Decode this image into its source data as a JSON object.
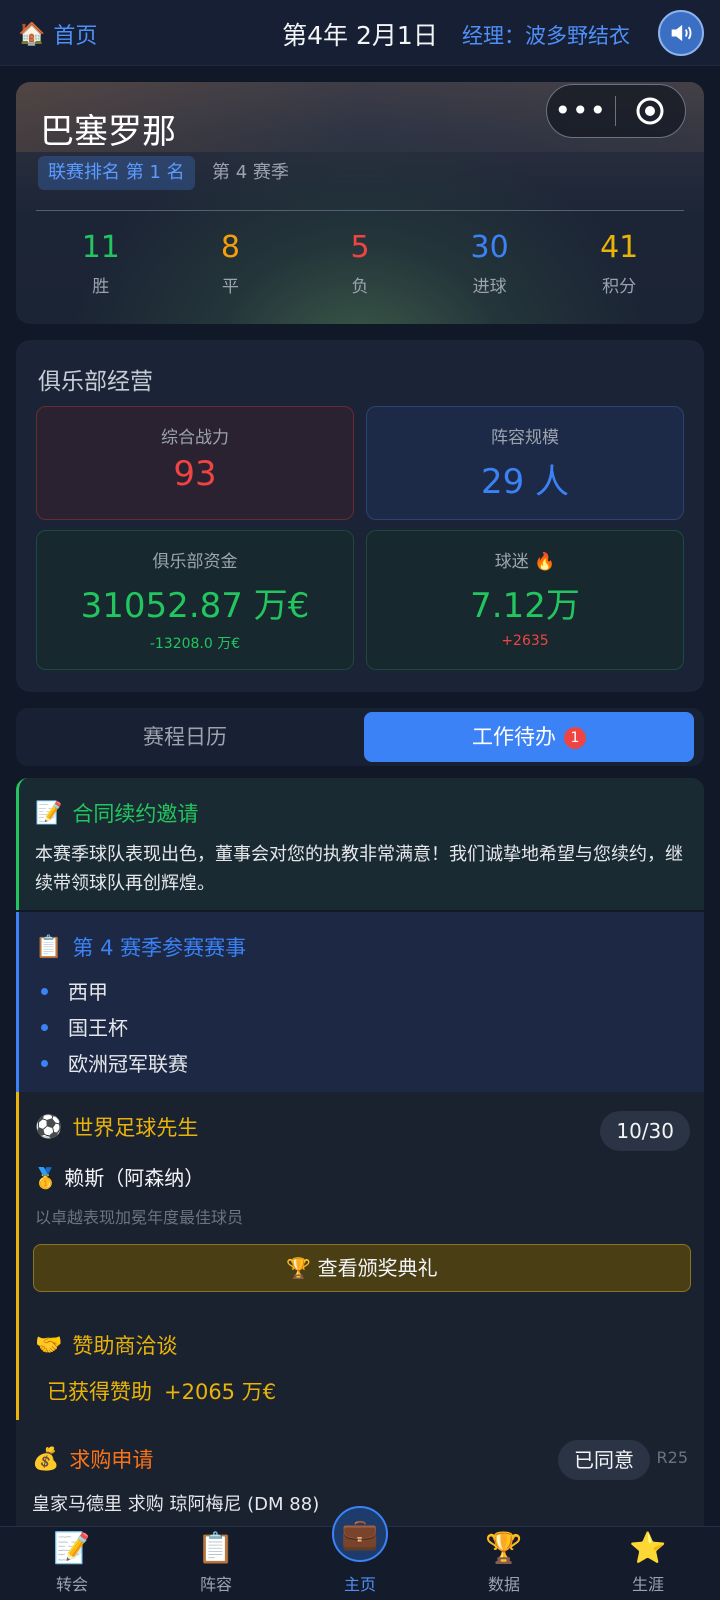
{
  "header": {
    "home_icon": "house-icon",
    "home_label": "首页",
    "date": "第4年 2月1日",
    "manager_label": "经理：波多野结衣",
    "sound_icon": "speaker-icon"
  },
  "team": {
    "name": "巴塞罗那",
    "rank": "联赛排名 第 1 名",
    "season": "第 4 赛季",
    "capsule_more": "•••",
    "stats": [
      {
        "value": "11",
        "label": "胜",
        "color": "#22c55e"
      },
      {
        "value": "8",
        "label": "平",
        "color": "#f59e0b"
      },
      {
        "value": "5",
        "label": "负",
        "color": "#ef4444"
      },
      {
        "value": "30",
        "label": "进球",
        "color": "#3b82f6"
      },
      {
        "value": "41",
        "label": "积分",
        "color": "#eab308"
      }
    ]
  },
  "club": {
    "title": "俱乐部经营",
    "power": {
      "label": "综合战力",
      "value": "93",
      "color": "#ef4444"
    },
    "squad": {
      "label": "阵容规模",
      "value": "29 人",
      "color": "#3b82f6"
    },
    "funds": {
      "label": "俱乐部资金",
      "value": "31052.87 万€",
      "change": "-13208.0 万€",
      "color": "#22c55e",
      "change_color": "#22c55e"
    },
    "fans": {
      "label": "球迷",
      "icon": "🔥",
      "value": "7.12万",
      "change": "+2635",
      "color": "#22c55e",
      "change_color": "#ef4444"
    }
  },
  "tabs": {
    "schedule": "赛程日历",
    "todo": "工作待办",
    "todo_badge": "1"
  },
  "tasks": {
    "contract": {
      "icon": "📝",
      "title": "合同续约邀请",
      "body": "本赛季球队表现出色，董事会对您的执教非常满意！我们诚挚地希望与您续约，继续带领球队再创辉煌。"
    },
    "competitions": {
      "icon": "📋",
      "title": "第 4 赛季参赛赛事",
      "items": [
        "西甲",
        "国王杯",
        "欧洲冠军联赛"
      ]
    },
    "award": {
      "icon": "⚽",
      "title": "世界足球先生",
      "progress": "10/30",
      "player_icon": "🥇",
      "player": "赖斯（阿森纳）",
      "desc": "以卓越表现加冕年度最佳球员",
      "button_icon": "🏆",
      "button": "查看颁奖典礼"
    },
    "sponsor": {
      "icon": "🤝",
      "title": "赞助商洽谈",
      "status": "已获得赞助",
      "amount": "+2065 万€"
    },
    "transfer": {
      "icon": "💰",
      "title": "求购申请",
      "status": "已同意",
      "round": "R25",
      "request": "皇家马德里 求购 琼阿梅尼 (DM 88)"
    }
  },
  "nav": [
    {
      "icon": "📝",
      "label": "转会"
    },
    {
      "icon": "📋",
      "label": "阵容"
    },
    {
      "icon": "💼",
      "label": "主页"
    },
    {
      "icon": "🏆",
      "label": "数据"
    },
    {
      "icon": "⭐",
      "label": "生涯"
    }
  ]
}
